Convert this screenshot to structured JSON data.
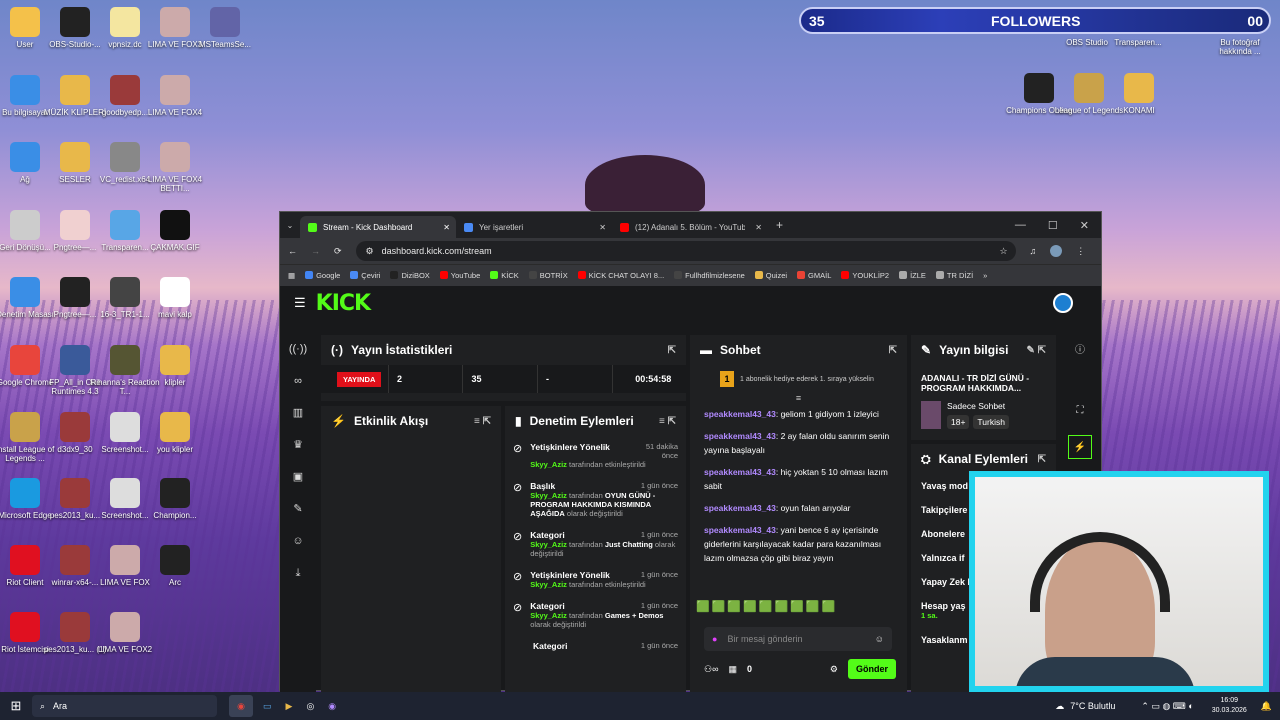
{
  "desktop_icons_left": [
    {
      "label": "User",
      "color": "#f4c14a"
    },
    {
      "label": "OBS-Studio-...",
      "color": "#222"
    },
    {
      "label": "vpnsiz.dc",
      "color": "#f4e6a0"
    },
    {
      "label": "LIMA VE FOX3",
      "color": "#caa"
    },
    {
      "label": "MSTeamsSe...",
      "color": "#6264a7"
    },
    {
      "label": "Bu bilgisayar",
      "color": "#3a8ee6"
    },
    {
      "label": "MÜZİK KLİPLERİ",
      "color": "#e8b84a"
    },
    {
      "label": "goodbyedp...",
      "color": "#9a3a3a"
    },
    {
      "label": "LIMA VE FOX4",
      "color": "#caa"
    },
    {
      "label": "Ağ",
      "color": "#3a8ee6"
    },
    {
      "label": "SESLER",
      "color": "#e8b84a"
    },
    {
      "label": "VC_redist.x64",
      "color": "#888"
    },
    {
      "label": "LIMA VE FOX4 BETTI...",
      "color": "#caa"
    },
    {
      "label": "Geri Dönüşü...",
      "color": "#ccc"
    },
    {
      "label": "Pngtree—...",
      "color": "#f0d0d0"
    },
    {
      "label": "Transparen...",
      "color": "#58a6e6"
    },
    {
      "label": "ÇAKMAK.GIF",
      "color": "#111"
    },
    {
      "label": "Denetim Masası",
      "color": "#3a8ee6"
    },
    {
      "label": "Pngtree—...",
      "color": "#222"
    },
    {
      "label": "16-3_TR1-1...",
      "color": "#444"
    },
    {
      "label": "mavi kalp",
      "color": "#fff"
    },
    {
      "label": "Google Chrome",
      "color": "#e8453c"
    },
    {
      "label": "FP_All_in One Runtimes 4.3",
      "color": "#3a5a9a"
    },
    {
      "label": "Rihanna's Reaction T...",
      "color": "#553"
    },
    {
      "label": "klipler",
      "color": "#e8b84a"
    },
    {
      "label": "Install League of Legends ...",
      "color": "#c9a24a"
    },
    {
      "label": "d3dx9_30",
      "color": "#9a3a3a"
    },
    {
      "label": "Screenshot...",
      "color": "#ddd"
    },
    {
      "label": "you klipler",
      "color": "#e8b84a"
    },
    {
      "label": "Microsoft Edge",
      "color": "#1a9ae0"
    },
    {
      "label": "pes2013_ku...",
      "color": "#9a3a3a"
    },
    {
      "label": "Screenshot...",
      "color": "#ddd"
    },
    {
      "label": "Champion...",
      "color": "#222"
    },
    {
      "label": "Riot Client",
      "color": "#e01020"
    },
    {
      "label": "winrar-x64-...",
      "color": "#9a3a3a"
    },
    {
      "label": "LIMA VE FOX",
      "color": "#caa"
    },
    {
      "label": "Arc",
      "color": "#222"
    },
    {
      "label": "Riot İstemcisi",
      "color": "#e01020"
    },
    {
      "label": "pes2013_ku... (1)",
      "color": "#9a3a3a"
    },
    {
      "label": "LIMA VE FOX2",
      "color": "#caa"
    }
  ],
  "desktop_icons_right": [
    {
      "label": "OBS Studio",
      "color": "#222"
    },
    {
      "label": "Transparen...",
      "color": "#222"
    },
    {
      "label": "Bu fotoğraf hakkında ...",
      "color": "#333"
    },
    {
      "label": "Champions Online",
      "color": "#222"
    },
    {
      "label": "League of Legends",
      "color": "#c9a24a"
    },
    {
      "label": "KONAMI",
      "color": "#e8b84a"
    }
  ],
  "followers_widget": {
    "count": "35",
    "label": "FOLLOWERS",
    "right": "00"
  },
  "browser": {
    "tabs": [
      {
        "title": "Stream - Kick Dashboard",
        "icon_color": "#53fc18",
        "active": true
      },
      {
        "title": "Yer işaretleri",
        "icon_color": "#4a8af4",
        "active": false
      },
      {
        "title": "(12) Adanalı 5. Bölüm - YouTub",
        "icon_color": "#ff0000",
        "active": false
      }
    ],
    "new_tab": "+",
    "url": "dashboard.kick.com/stream",
    "bookmarks": [
      {
        "label": "Google",
        "color": "#4285f4"
      },
      {
        "label": "Çeviri",
        "color": "#4a8af4"
      },
      {
        "label": "DiziBOX",
        "color": "#222"
      },
      {
        "label": "YouTube",
        "color": "#ff0000"
      },
      {
        "label": "KİCK",
        "color": "#53fc18"
      },
      {
        "label": "BOTRİX",
        "color": "#444"
      },
      {
        "label": "KİCK CHAT OLAYI 8...",
        "color": "#ff0000"
      },
      {
        "label": "Fullhdfilmizlesene",
        "color": "#444"
      },
      {
        "label": "Quizei",
        "color": "#e8b84a"
      },
      {
        "label": "GMAİL",
        "color": "#ea4335"
      },
      {
        "label": "YOUKLİP2",
        "color": "#ff0000"
      },
      {
        "label": "İZLE",
        "color": "#aaa"
      },
      {
        "label": "TR DİZİ",
        "color": "#aaa"
      }
    ]
  },
  "kick": {
    "logo": "KICK",
    "stats": {
      "title": "Yayın İstatistikleri",
      "live": "YAYINDA",
      "viewers": "2",
      "followers": "35",
      "subs": "-",
      "uptime": "00:54:58"
    },
    "activity": {
      "title": "Etkinlik Akışı"
    },
    "moderation": {
      "title": "Denetim Eylemleri",
      "items": [
        {
          "title": "Yetişkinlere Yönelik",
          "time": "51 dakika önce",
          "user": "Skyy_Aziz",
          "text": "tarafından etkinleştirildi",
          "extra": "",
          "tail": ""
        },
        {
          "title": "Başlık",
          "time": "1 gün önce",
          "user": "Skyy_Aziz",
          "text": "tarafından",
          "extra": "OYUN GÜNÜ - PROGRAM HAKKIMDA KISMINDA AŞAĞIDA",
          "tail": "olarak değiştirildi"
        },
        {
          "title": "Kategori",
          "time": "1 gün önce",
          "user": "Skyy_Aziz",
          "text": "tarafından",
          "extra": "Just Chatting",
          "tail": "olarak değiştirildi"
        },
        {
          "title": "Yetişkinlere Yönelik",
          "time": "1 gün önce",
          "user": "Skyy_Aziz",
          "text": "tarafından etkinleştirildi",
          "extra": "",
          "tail": ""
        },
        {
          "title": "Kategori",
          "time": "1 gün önce",
          "user": "Skyy_Aziz",
          "text": "tarafından",
          "extra": "Games + Demos",
          "tail": "olarak değiştirildi"
        }
      ],
      "partial": "Kategori",
      "partial_time": "1 gün önce"
    },
    "chat": {
      "title": "Sohbet",
      "goal_number": "1",
      "goal": "1 abonelik hediye ederek 1. sıraya yükselin",
      "messages": [
        {
          "user": "speakkemal43_43",
          "text": "geliom 1 gidiyom 1 izleyici"
        },
        {
          "user": "speakkemal43_43",
          "text": "2 ay falan oldu sanırım senin yayına başlayalı"
        },
        {
          "user": "speakkemal43_43",
          "text": "hiç yoktan 5 10 olması lazım sabit"
        },
        {
          "user": "speakkemal43_43",
          "text": "oyun falan arıyolar"
        },
        {
          "user": "speakkemal43_43",
          "text": "yani bence 6 ay içerisinde giderlerini karşılayacak kadar para kazanılması lazım olmazsa çöp gibi biraz yayın"
        }
      ],
      "placeholder": "Bir mesaj gönderin",
      "points": "0",
      "send": "Gönder"
    },
    "stream_info": {
      "title": "Yayın bilgisi",
      "stream_title": "ADANALI - TR DİZİ GÜNÜ - PROGRAM HAKKIMDA...",
      "category": "Sadece Sohbet",
      "tag1": "18+",
      "tag2": "Turkish"
    },
    "channel_actions": {
      "title": "Kanal Eylemleri",
      "items": [
        "Yavaş mod",
        "Takipçilere",
        "Abonelere",
        "Yalnızca if",
        "Yapay Zek Denetimi",
        "Hesap yaş",
        "Yasaklanm"
      ],
      "sub": "1 sa."
    }
  },
  "taskbar": {
    "search": "Ara",
    "weather": "7°C Bulutlu",
    "time": "16:09",
    "date": "30.03.2026"
  }
}
